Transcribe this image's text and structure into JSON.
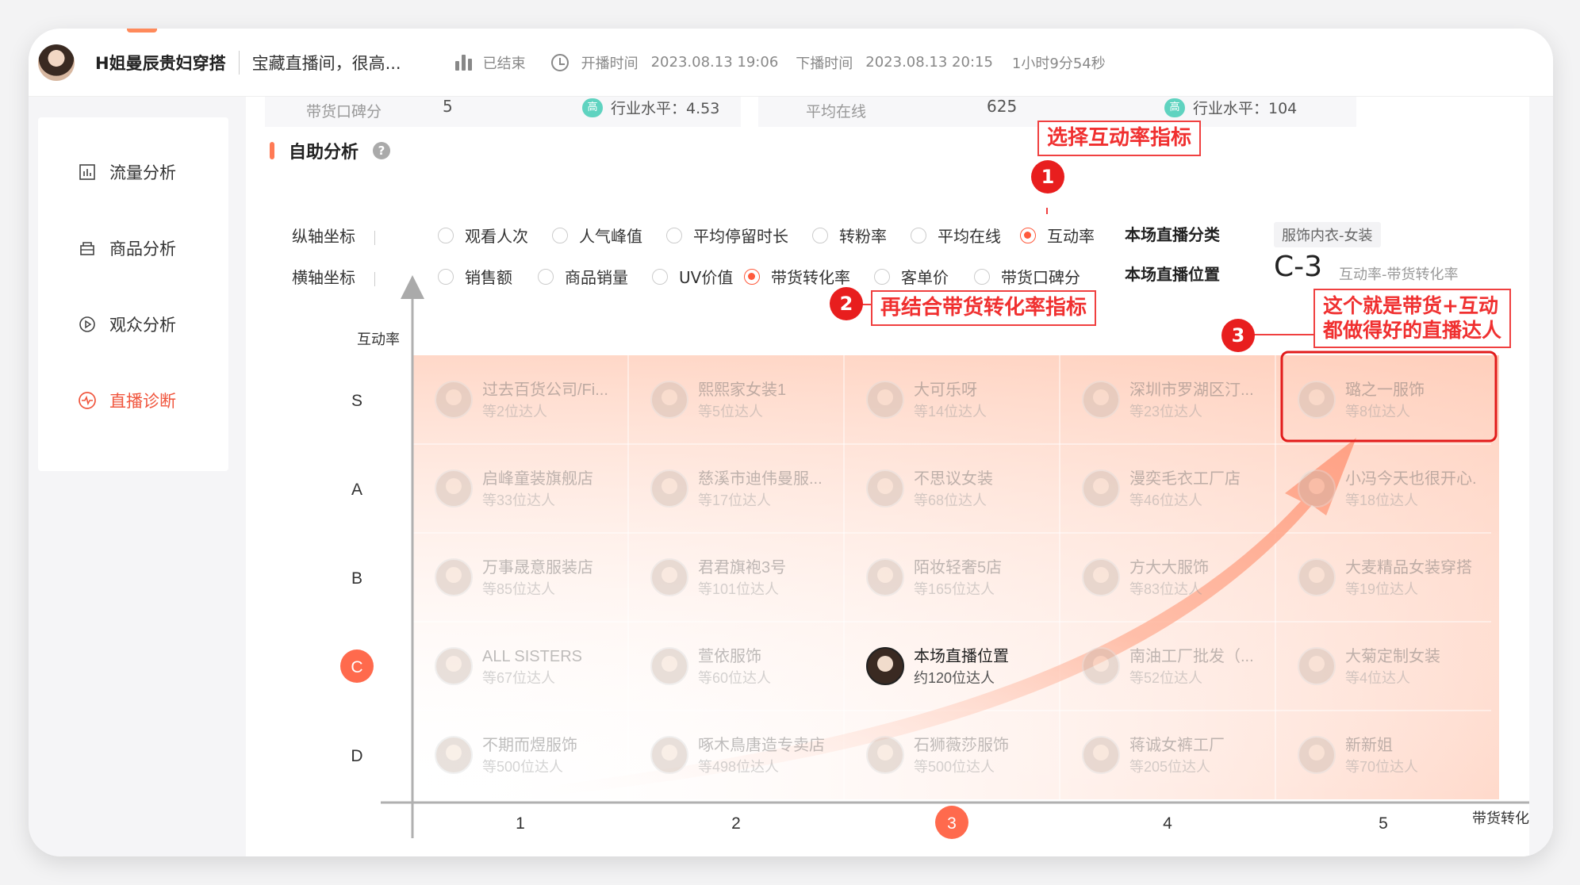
{
  "header": {
    "streamer_name": "H姐曼辰贵妇穿搭",
    "room_title": "宝藏直播间，很高...",
    "status": "已结束",
    "start_label": "开播时间",
    "start_time": "2023.08.13 19:06",
    "end_label": "下播时间",
    "end_time": "2023.08.13 20:15",
    "duration": "1小时9分54秒"
  },
  "sidebar": {
    "items": [
      {
        "label": "流量分析",
        "icon": "bar-chart-icon",
        "active": false
      },
      {
        "label": "商品分析",
        "icon": "goods-icon",
        "active": false
      },
      {
        "label": "观众分析",
        "icon": "play-circle-icon",
        "active": false
      },
      {
        "label": "直播诊断",
        "icon": "pulse-icon",
        "active": true
      }
    ]
  },
  "prev_row": {
    "left_label": "带货口碑分",
    "left_value": "5",
    "left_badge": "高",
    "left_industry": "行业水平：4.53",
    "right_label": "平均在线",
    "right_value": "625",
    "right_badge": "高",
    "right_industry": "行业水平：104"
  },
  "section": {
    "title": "自助分析",
    "help": "?"
  },
  "y_axis_options": {
    "label": "纵轴坐标",
    "options": [
      "观看人次",
      "人气峰值",
      "平均停留时长",
      "转粉率",
      "平均在线",
      "互动率"
    ],
    "selected": "互动率"
  },
  "x_axis_options": {
    "label": "横轴坐标",
    "options": [
      "销售额",
      "商品销量",
      "UV价值",
      "带货转化率",
      "客单价",
      "带货口碑分"
    ],
    "selected": "带货转化率"
  },
  "category": {
    "label": "本场直播分类",
    "value": "服饰内衣-女装"
  },
  "position": {
    "label": "本场直播位置",
    "value": "C-3",
    "desc": "互动率-带货转化率"
  },
  "annotations": {
    "one": {
      "num": "1",
      "text": "选择互动率指标"
    },
    "two": {
      "num": "2",
      "text": "再结合带货转化率指标"
    },
    "three": {
      "num": "3",
      "text_line1": "这个就是带货+互动",
      "text_line2": "都做得好的直播达人"
    }
  },
  "colors": {
    "accent": "#ff5a3c",
    "annotation_red": "#e81e1e"
  },
  "chart_data": {
    "type": "table",
    "ylabel": "互动率",
    "xlabel": "带货转化率",
    "y_levels": [
      "S",
      "A",
      "B",
      "C",
      "D"
    ],
    "x_levels": [
      "1",
      "2",
      "3",
      "4",
      "5"
    ],
    "current": {
      "row": "C",
      "col": "3"
    },
    "cells": [
      [
        {
          "name": "过去百货公司/Fi...",
          "count": "等2位达人"
        },
        {
          "name": "熙熙家女装1",
          "count": "等5位达人"
        },
        {
          "name": "大可乐呀",
          "count": "等14位达人"
        },
        {
          "name": "深圳市罗湖区汀...",
          "count": "等23位达人"
        },
        {
          "name": "璐之一服饰",
          "count": "等8位达人"
        }
      ],
      [
        {
          "name": "启峰童装旗舰店",
          "count": "等33位达人"
        },
        {
          "name": "慈溪市迪伟曼服...",
          "count": "等17位达人"
        },
        {
          "name": "不思议女装",
          "count": "等68位达人"
        },
        {
          "name": "漫奕毛衣工厂店",
          "count": "等46位达人"
        },
        {
          "name": "小冯今天也很开心.",
          "count": "等18位达人"
        }
      ],
      [
        {
          "name": "万事晟意服装店",
          "count": "等85位达人"
        },
        {
          "name": "君君旗袍3号",
          "count": "等101位达人"
        },
        {
          "name": "陌妆轻奢5店",
          "count": "等165位达人"
        },
        {
          "name": "方大大服饰",
          "count": "等83位达人"
        },
        {
          "name": "大麦精品女装穿搭",
          "count": "等19位达人"
        }
      ],
      [
        {
          "name": "ALL SISTERS",
          "count": "等67位达人"
        },
        {
          "name": "萱依服饰",
          "count": "等60位达人"
        },
        {
          "name": "本场直播位置",
          "count": "约120位达人"
        },
        {
          "name": "南油工厂批发（...",
          "count": "等52位达人"
        },
        {
          "name": "大菊定制女装",
          "count": "等4位达人"
        }
      ],
      [
        {
          "name": "不期而煜服饰",
          "count": "等500位达人"
        },
        {
          "name": "啄木鳥唐造专卖店",
          "count": "等498位达人"
        },
        {
          "name": "石狮薇莎服饰",
          "count": "等500位达人"
        },
        {
          "name": "蒋诚女裤工厂",
          "count": "等205位达人"
        },
        {
          "name": "新新姐",
          "count": "等70位达人"
        }
      ]
    ]
  }
}
